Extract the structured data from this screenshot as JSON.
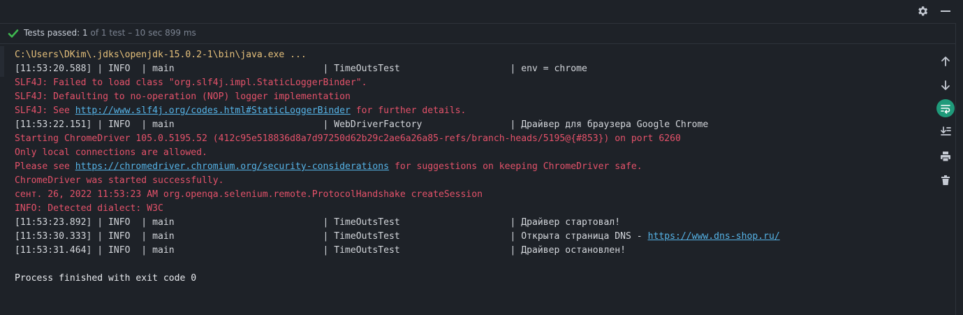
{
  "header": {
    "settings_icon": "gear-icon",
    "hide_icon": "minus-icon"
  },
  "status": {
    "icon": "check-icon",
    "label": "Tests passed:",
    "count": "1",
    "detail": "of 1 test – 10 sec 899 ms",
    "color": "#3fb950"
  },
  "console": {
    "lines": [
      {
        "segments": [
          {
            "text": "C:\\Users\\DKim\\.jdks\\openjdk-15.0.2-1\\bin\\java.exe ...",
            "type": "cmd"
          }
        ]
      },
      {
        "segments": [
          {
            "text": "[11:53:20.588] | INFO  | main                           | TimeOutsTest                    | env = chrome",
            "type": "info"
          }
        ]
      },
      {
        "segments": [
          {
            "text": "SLF4J: Failed to load class \"org.slf4j.impl.StaticLoggerBinder\".",
            "type": "err"
          }
        ]
      },
      {
        "segments": [
          {
            "text": "SLF4J: Defaulting to no-operation (NOP) logger implementation",
            "type": "err"
          }
        ]
      },
      {
        "segments": [
          {
            "text": "SLF4J: See ",
            "type": "err"
          },
          {
            "text": "http://www.slf4j.org/codes.html#StaticLoggerBinder",
            "type": "link"
          },
          {
            "text": " for further details.",
            "type": "err"
          }
        ]
      },
      {
        "segments": [
          {
            "text": "[11:53:22.151] | INFO  | main                           | WebDriverFactory                | Драйвер для браузера Google Chrome",
            "type": "info"
          }
        ]
      },
      {
        "segments": [
          {
            "text": "Starting ChromeDriver 105.0.5195.52 (412c95e518836d8a7d97250d62b29c2ae6a26a85-refs/branch-heads/5195@{#853}) on port 6260",
            "type": "err"
          }
        ]
      },
      {
        "segments": [
          {
            "text": "Only local connections are allowed.",
            "type": "err"
          }
        ]
      },
      {
        "segments": [
          {
            "text": "Please see ",
            "type": "err"
          },
          {
            "text": "https://chromedriver.chromium.org/security-considerations",
            "type": "link"
          },
          {
            "text": " for suggestions on keeping ChromeDriver safe.",
            "type": "err"
          }
        ]
      },
      {
        "segments": [
          {
            "text": "ChromeDriver was started successfully.",
            "type": "err"
          }
        ]
      },
      {
        "segments": [
          {
            "text": "сент. 26, 2022 11:53:23 AM org.openqa.selenium.remote.ProtocolHandshake createSession",
            "type": "err"
          }
        ]
      },
      {
        "segments": [
          {
            "text": "INFO: Detected dialect: W3C",
            "type": "err"
          }
        ]
      },
      {
        "segments": [
          {
            "text": "[11:53:23.892] | INFO  | main                           | TimeOutsTest                    | Драйвер стартовал!",
            "type": "info"
          }
        ]
      },
      {
        "segments": [
          {
            "text": "[11:53:30.333] | INFO  | main                           | TimeOutsTest                    | Открыта страница DNS - ",
            "type": "info"
          },
          {
            "text": "https://www.dns-shop.ru/",
            "type": "link"
          }
        ]
      },
      {
        "segments": [
          {
            "text": "[11:53:31.464] | INFO  | main                           | TimeOutsTest                    | Драйвер остановлен!",
            "type": "info"
          }
        ]
      },
      {
        "segments": [
          {
            "text": "",
            "type": "info"
          }
        ]
      },
      {
        "segments": [
          {
            "text": "Process finished with exit code 0",
            "type": "final"
          }
        ]
      }
    ]
  },
  "toolbar": {
    "items": [
      {
        "name": "up-arrow-icon"
      },
      {
        "name": "down-arrow-icon"
      },
      {
        "name": "soft-wrap-icon",
        "active": true
      },
      {
        "name": "scroll-to-end-icon"
      },
      {
        "name": "print-icon"
      },
      {
        "name": "trash-icon"
      }
    ]
  },
  "colors": {
    "background": "#1e2228",
    "command": "#e5c07b",
    "info": "#d4d7dc",
    "error": "#e5526a",
    "link": "#56b4e8",
    "active_tool": "#1f9a7a"
  }
}
